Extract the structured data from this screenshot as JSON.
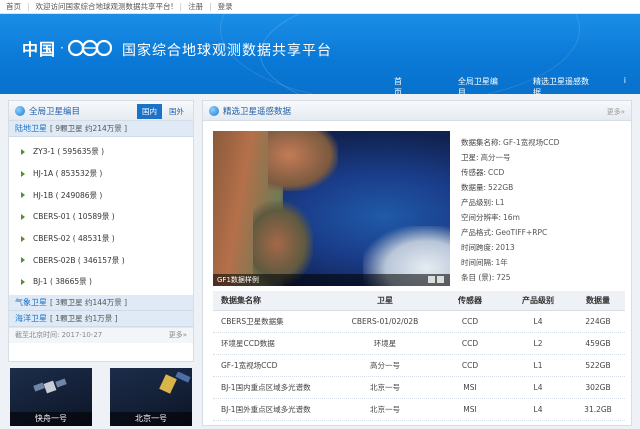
{
  "topbar": {
    "home": "首页",
    "welcome": "欢迎访问国家综合地球观测数据共享平台!",
    "register": "注册",
    "login": "登录"
  },
  "header": {
    "logo_text": "中国",
    "site_title": "国家综合地球观测数据共享平台",
    "nav": [
      "首 页",
      "全局卫星编目",
      "精选卫星遥感数据",
      "i"
    ]
  },
  "left_panel": {
    "title": "全局卫星编目",
    "tabs": [
      "国内",
      "国外"
    ],
    "active_tab": "国内",
    "land": {
      "name": "陆地卫星",
      "summary": "[ 9颗卫星 约214万景 ]"
    },
    "satellites": [
      {
        "label": "ZY3-1 ( 595635景 )"
      },
      {
        "label": "HJ-1A ( 853532景 )"
      },
      {
        "label": "HJ-1B ( 249086景 )"
      },
      {
        "label": "CBERS-01 ( 10589景 )"
      },
      {
        "label": "CBERS-02 ( 48531景 )"
      },
      {
        "label": "CBERS-02B ( 346157景 )"
      },
      {
        "label": "BJ-1 ( 38665景 )"
      }
    ],
    "weather": {
      "name": "气象卫星",
      "summary": "[ 3颗卫星 约144万景 ]"
    },
    "ocean": {
      "name": "海洋卫星",
      "summary": "[ 1颗卫星 约1万景 ]"
    },
    "update_time": "截至北京时间: 2017-10-27",
    "more": "更多»"
  },
  "thumbs": [
    "快舟一号",
    "北京一号"
  ],
  "right_panel": {
    "title": "精选卫星遥感数据",
    "more": "更多»",
    "image_caption": "GF1数据样例",
    "info": [
      {
        "key": "数据集名称:",
        "val": "GF-1宽视场CCD"
      },
      {
        "key": "卫星:",
        "val": "高分一号"
      },
      {
        "key": "传感器:",
        "val": "CCD"
      },
      {
        "key": "数据量:",
        "val": "522GB"
      },
      {
        "key": "产品级别:",
        "val": "L1"
      },
      {
        "key": "空间分辨率:",
        "val": "16m"
      },
      {
        "key": "产品格式:",
        "val": "GeoTIFF+RPC"
      },
      {
        "key": "时间跨度:",
        "val": "2013"
      },
      {
        "key": "时间间隔:",
        "val": "1年"
      },
      {
        "key": "条目 (景):",
        "val": "725"
      }
    ],
    "table": {
      "headers": [
        "数据集名称",
        "卫星",
        "传感器",
        "产品级别",
        "数据量"
      ],
      "rows": [
        [
          "CBERS卫星数据集",
          "CBERS-01/02/02B",
          "CCD",
          "L4",
          "224GB"
        ],
        [
          "环境星CCD数据",
          "环境星",
          "CCD",
          "L2",
          "459GB"
        ],
        [
          "GF-1宽视场CCD",
          "高分一号",
          "CCD",
          "L1",
          "522GB"
        ],
        [
          "BJ-1国内重点区域多光谱数",
          "北京一号",
          "MSI",
          "L4",
          "302GB"
        ],
        [
          "BJ-1国外重点区域多光谱数",
          "北京一号",
          "MSI",
          "L4",
          "31.2GB"
        ]
      ]
    }
  }
}
